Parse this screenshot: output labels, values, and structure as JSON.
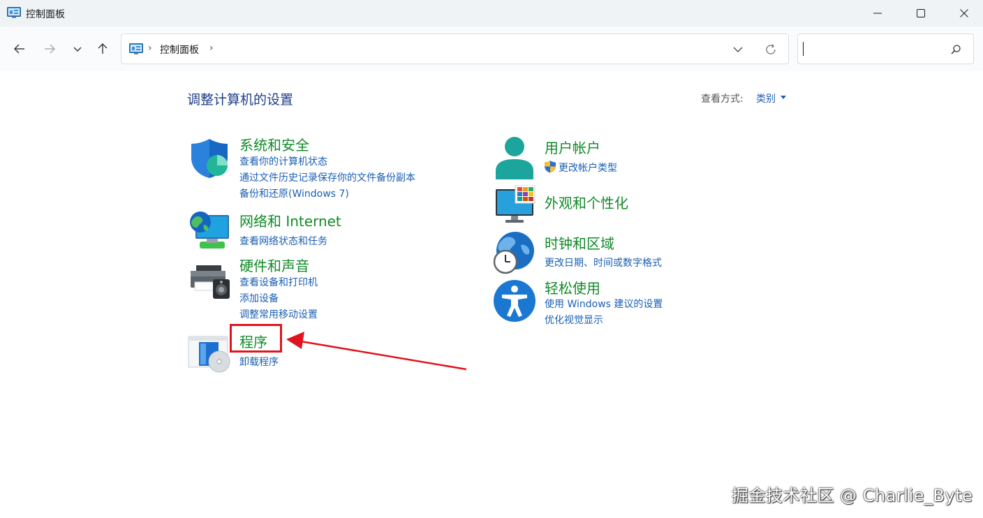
{
  "window": {
    "title": "控制面板",
    "minimize_icon": "minimize-icon",
    "maximize_icon": "maximize-icon",
    "close_icon": "close-icon"
  },
  "nav": {
    "back_icon": "arrow-left-icon",
    "forward_icon": "arrow-right-icon",
    "recent_icon": "chevron-down-icon",
    "up_icon": "arrow-up-icon"
  },
  "address": {
    "crumb": "控制面板",
    "separator": "›"
  },
  "search": {
    "value": "",
    "placeholder": ""
  },
  "main": {
    "heading": "调整计算机的设置",
    "view_by_label": "查看方式:",
    "view_by_value": "类别"
  },
  "categories": {
    "system_security": {
      "title": "系统和安全",
      "links": [
        "查看你的计算机状态",
        "通过文件历史记录保存你的文件备份副本",
        "备份和还原(Windows 7)"
      ]
    },
    "network": {
      "title": "网络和 Internet",
      "links": [
        "查看网络状态和任务"
      ]
    },
    "hardware": {
      "title": "硬件和声音",
      "links": [
        "查看设备和打印机",
        "添加设备",
        "调整常用移动设置"
      ]
    },
    "programs": {
      "title": "程序",
      "links": [
        "卸载程序"
      ]
    },
    "user_accounts": {
      "title": "用户帐户",
      "links": [
        "更改帐户类型"
      ]
    },
    "appearance": {
      "title": "外观和个性化",
      "links": []
    },
    "clock_region": {
      "title": "时钟和区域",
      "links": [
        "更改日期、时间或数字格式"
      ]
    },
    "ease_of_access": {
      "title": "轻松使用",
      "links": [
        "使用 Windows 建议的设置",
        "优化视觉显示"
      ]
    }
  },
  "annotation": {
    "highlight_color": "#e0141e"
  },
  "watermark": {
    "text": "掘金技术社区 @ Charlie_Byte"
  },
  "colors": {
    "category_title": "#108a28",
    "link": "#1a5fb4",
    "heading": "#1e3e8a"
  }
}
